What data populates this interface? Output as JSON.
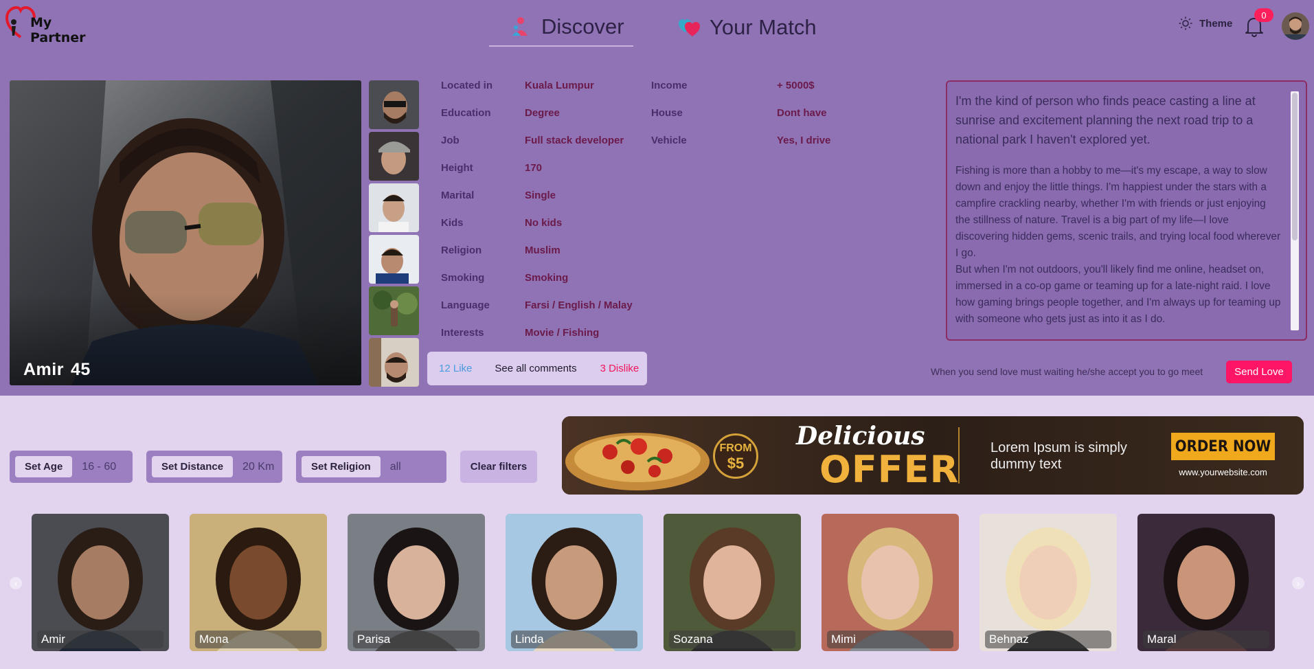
{
  "app": {
    "logo_line1": "My",
    "logo_line2": "Partner"
  },
  "nav": {
    "discover": "Discover",
    "match": "Your Match"
  },
  "header": {
    "theme_label": "Theme",
    "notification_count": "0"
  },
  "profile": {
    "name": "Amir",
    "age": "45",
    "details_left": [
      {
        "key": "Located in",
        "value": "Kuala Lumpur"
      },
      {
        "key": "Education",
        "value": "Degree"
      },
      {
        "key": "Job",
        "value": "Full stack developer"
      },
      {
        "key": "Height",
        "value": "170"
      },
      {
        "key": "Marital",
        "value": "Single"
      },
      {
        "key": "Kids",
        "value": "No kids"
      },
      {
        "key": "Religion",
        "value": "Muslim"
      },
      {
        "key": "Smoking",
        "value": "Smoking"
      },
      {
        "key": "Language",
        "value": "Farsi / English / Malay"
      },
      {
        "key": "Interests",
        "value": "Movie / Fishing"
      }
    ],
    "details_right": [
      {
        "key": "Income",
        "value": "+ 5000$"
      },
      {
        "key": "House",
        "value": "Dont have"
      },
      {
        "key": "Vehicle",
        "value": "Yes, I drive"
      }
    ],
    "likes": "12 Like",
    "comments": "See all comments",
    "dislikes": "3 Dislike",
    "bio_intro": "I'm the kind of person who finds peace casting a line at sunrise and excitement planning the next road trip to a national park I haven't explored yet.",
    "bio_p1": "Fishing is more than a hobby to me—it's my escape, a way to slow down and enjoy the little things. I'm happiest under the stars with a campfire crackling nearby, whether I'm with friends or just enjoying the stillness of nature. Travel is a big part of my life—I love discovering hidden gems, scenic trails, and trying local food wherever I go.",
    "bio_p2": "But when I'm not outdoors, you'll likely find me online, headset on, immersed in a co-op game or teaming up for a late-night raid. I love how gaming brings people together, and I'm always up for teaming up with someone who gets just as into it as I do."
  },
  "love": {
    "note": "When you send love must waiting he/she accept you to go meet",
    "button": "Send Love"
  },
  "filters": {
    "age_label": "Set Age",
    "age_value": "16 - 60",
    "distance_label": "Set Distance",
    "distance_value": "20 Km",
    "religion_label": "Set Religion",
    "religion_value": "all",
    "clear_label": "Clear filters"
  },
  "ad": {
    "from": "FROM",
    "price": "$5",
    "headline1": "Delicious",
    "headline2": "OFFER",
    "body": "Lorem Ipsum is simply dummy text",
    "cta": "ORDER NOW",
    "site": "www.yourwebsite.com"
  },
  "carousel": {
    "cards": [
      {
        "name": "Amir"
      },
      {
        "name": "Mona"
      },
      {
        "name": "Parisa"
      },
      {
        "name": "Linda"
      },
      {
        "name": "Sozana"
      },
      {
        "name": "Mimi"
      },
      {
        "name": "Behnaz"
      },
      {
        "name": "Maral"
      }
    ]
  },
  "colors": {
    "accent": "#ff1565",
    "header_bg": "#8f73b5",
    "page_bg": "#e2d4ee",
    "like": "#4a9be0",
    "dislike": "#f0155a"
  }
}
